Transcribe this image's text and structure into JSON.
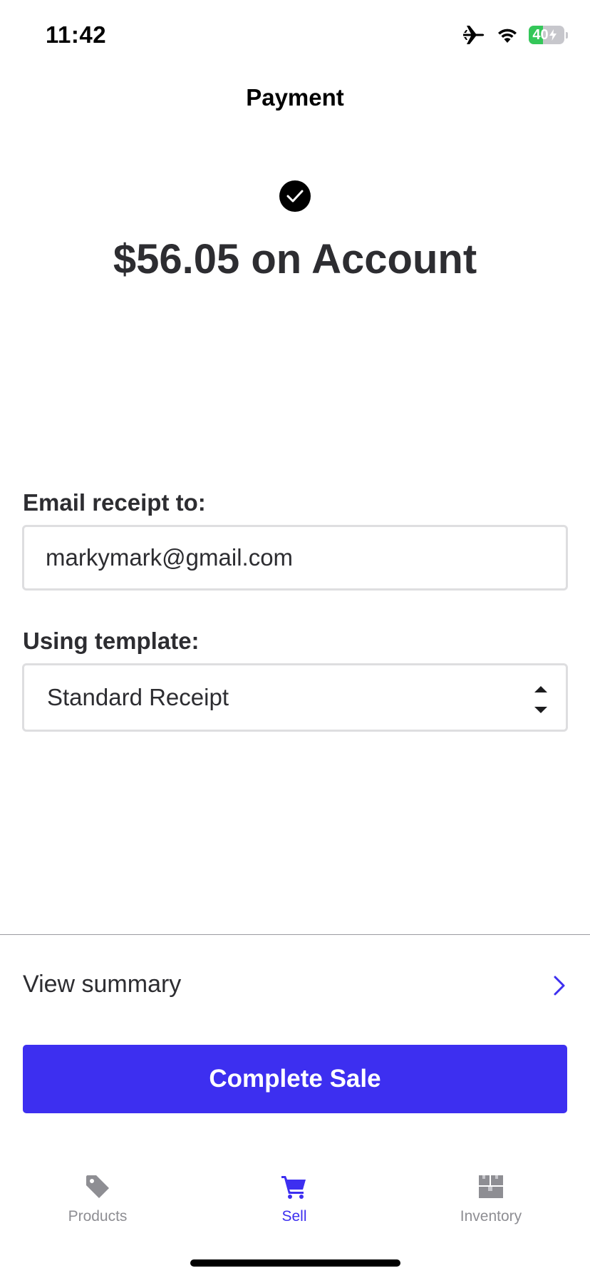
{
  "status_bar": {
    "time": "11:42",
    "battery_level": "40",
    "battery_fraction": 0.4,
    "icons": [
      "airplane-icon",
      "wifi-icon",
      "battery-charging-icon"
    ]
  },
  "header": {
    "title": "Payment"
  },
  "success": {
    "icon": "checkmark-circle-icon",
    "amount_text": "$56.05 on Account"
  },
  "form": {
    "email_label": "Email receipt to:",
    "email_value": "markymark@gmail.com",
    "template_label": "Using template:",
    "template_value": "Standard Receipt"
  },
  "summary": {
    "label": "View summary"
  },
  "actions": {
    "complete_label": "Complete Sale"
  },
  "tab_bar": {
    "tabs": [
      {
        "label": "Products",
        "icon": "tag-icon",
        "active": false
      },
      {
        "label": "Sell",
        "icon": "cart-icon",
        "active": true
      },
      {
        "label": "Inventory",
        "icon": "boxes-icon",
        "active": false
      }
    ]
  },
  "colors": {
    "accent": "#3d2ff0",
    "battery_green": "#34c759",
    "inactive_tab": "#8e8e93",
    "text": "#2d2d31"
  }
}
